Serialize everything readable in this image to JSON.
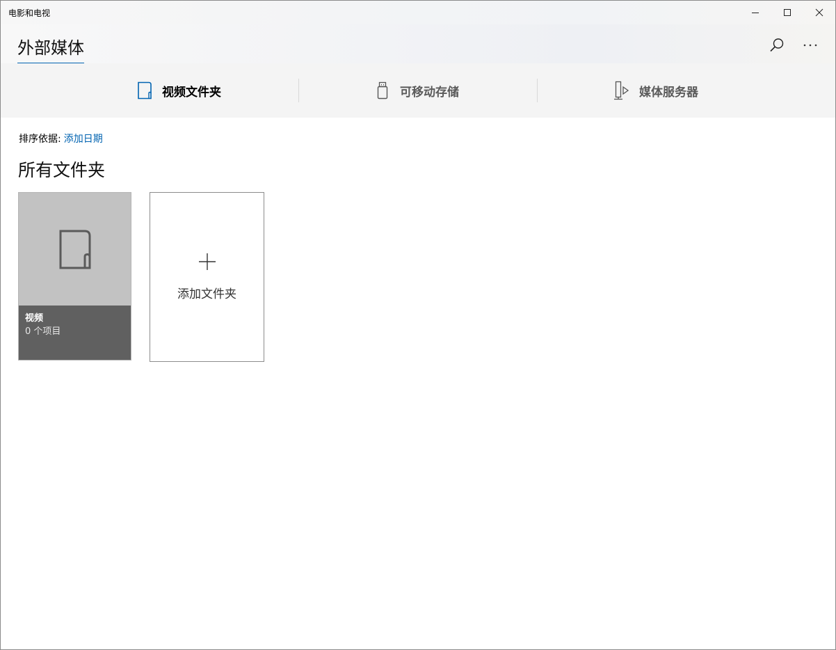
{
  "window": {
    "app_title": "电影和电视"
  },
  "header": {
    "page_title": "外部媒体"
  },
  "tabs": [
    {
      "label": "视频文件夹",
      "icon": "folder-icon",
      "selected": true
    },
    {
      "label": "可移动存储",
      "icon": "usb-drive-icon",
      "selected": false
    },
    {
      "label": "媒体服务器",
      "icon": "media-server-icon",
      "selected": false
    }
  ],
  "sort": {
    "label": "排序依据:",
    "value": "添加日期"
  },
  "section": {
    "title": "所有文件夹"
  },
  "folders": [
    {
      "name": "视频",
      "count_text": "0 个项目"
    }
  ],
  "add_folder": {
    "label": "添加文件夹"
  },
  "colors": {
    "accent": "#0063b1",
    "tile_bg": "#c2c2c2",
    "tile_info_bg": "#606060"
  }
}
